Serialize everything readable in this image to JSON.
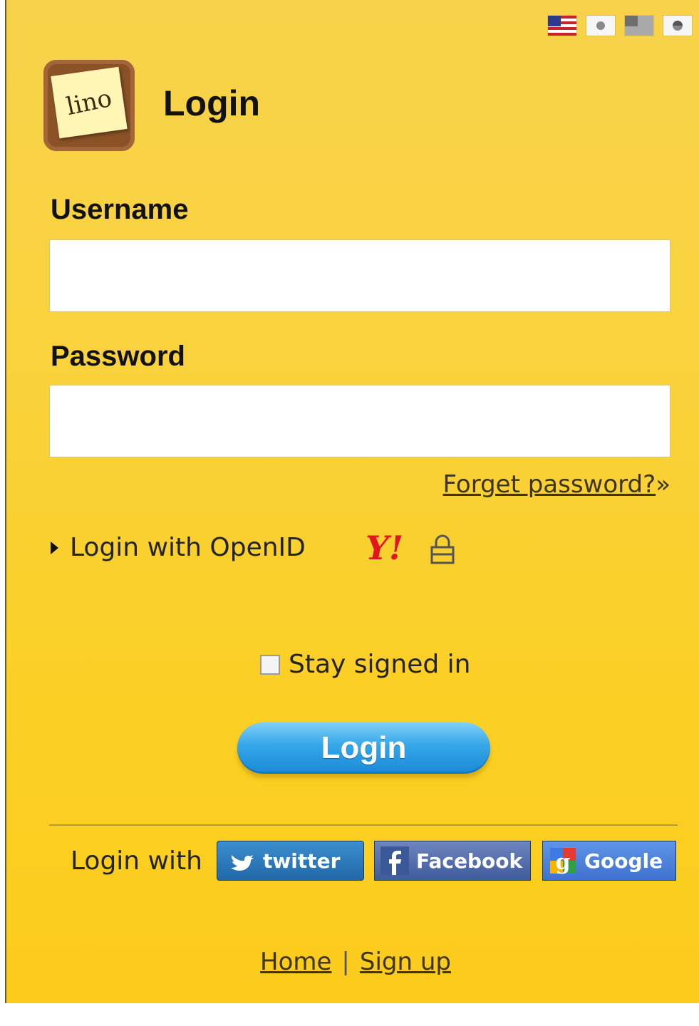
{
  "header": {
    "title": "Login"
  },
  "logo": {
    "text": "lino"
  },
  "languages": [
    "flag-us-icon",
    "flag-jp-icon",
    "flag-tw-icon",
    "flag-kr-icon"
  ],
  "form": {
    "username_label": "Username",
    "username_value": "",
    "password_label": "Password",
    "password_value": "",
    "forgot_label": "Forget password?",
    "forgot_suffix": "»",
    "openid_label": "Login with OpenID",
    "yahoo_label": "Y!",
    "stay_label": "Stay signed in",
    "login_label": "Login"
  },
  "social": {
    "label": "Login with",
    "twitter": "twitter",
    "facebook": "Facebook",
    "google": "Google"
  },
  "footer": {
    "home": "Home",
    "separator": "|",
    "signup": "Sign up"
  },
  "colors": {
    "background": "#fbd02a",
    "login_button": "#2a9be2",
    "twitter": "#2a78bb",
    "facebook": "#4c66a8",
    "google": "#4a80dc"
  }
}
